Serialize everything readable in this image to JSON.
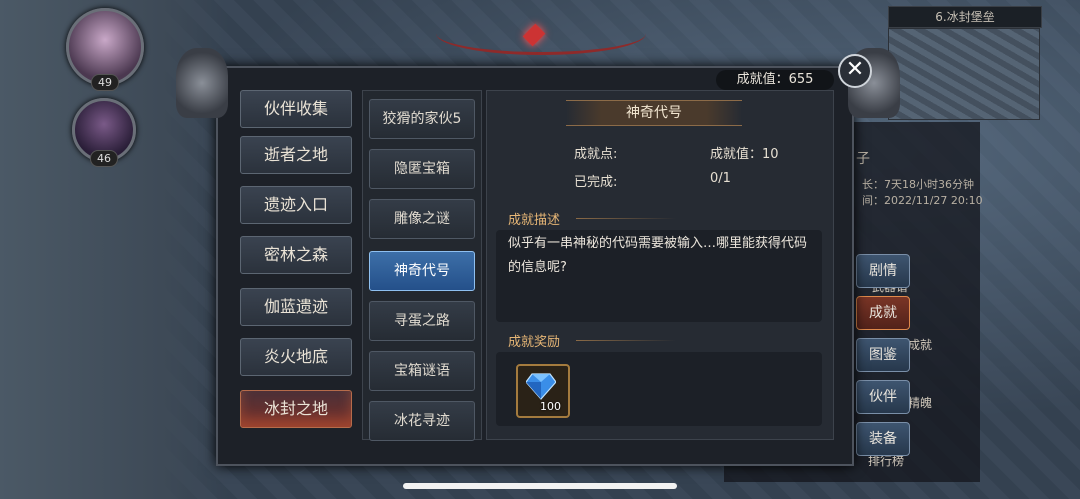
{
  "portraits": [
    {
      "level": "49"
    },
    {
      "level": "46"
    }
  ],
  "minimap": {
    "title": "6.冰封堡垒"
  },
  "right_panel": {
    "name_fragment": "子",
    "time_line1": "长：7天18小时36分钟",
    "time_line2": "间：2022/11/27 20:10",
    "label_tree": "武器谱",
    "label_achievement": "成就",
    "label_soul": "精魄",
    "label_rank": "排行榜"
  },
  "side_buttons": [
    "剧情",
    "成就",
    "图鉴",
    "伙伴",
    "装备"
  ],
  "dialog": {
    "score": "成就值：655",
    "close_symbol": "✕",
    "categories": [
      "伙伴收集",
      "逝者之地",
      "遗迹入口",
      "密林之森",
      "伽蓝遗迹",
      "炎火地底",
      "冰封之地"
    ],
    "active_category_index": 6,
    "achievements": [
      "狡猾的家伙5",
      "隐匿宝箱",
      "雕像之谜",
      "神奇代号",
      "寻蛋之路",
      "宝箱谜语",
      "冰花寻迹"
    ],
    "active_achievement_index": 3,
    "detail": {
      "title": "神奇代号",
      "points_label": "成就点:",
      "points_value": "成就值：10",
      "completed_label": "已完成:",
      "completed_value": "0/1",
      "desc_header": "成就描述",
      "description": "似乎有一串神秘的代码需要被输入…哪里能获得代码的信息呢?",
      "reward_header": "成就奖励",
      "reward_count": "100"
    }
  },
  "colors": {
    "active_category": "#7a3028",
    "active_achievement": "#3d6fa8",
    "section_header": "#e6b676"
  }
}
